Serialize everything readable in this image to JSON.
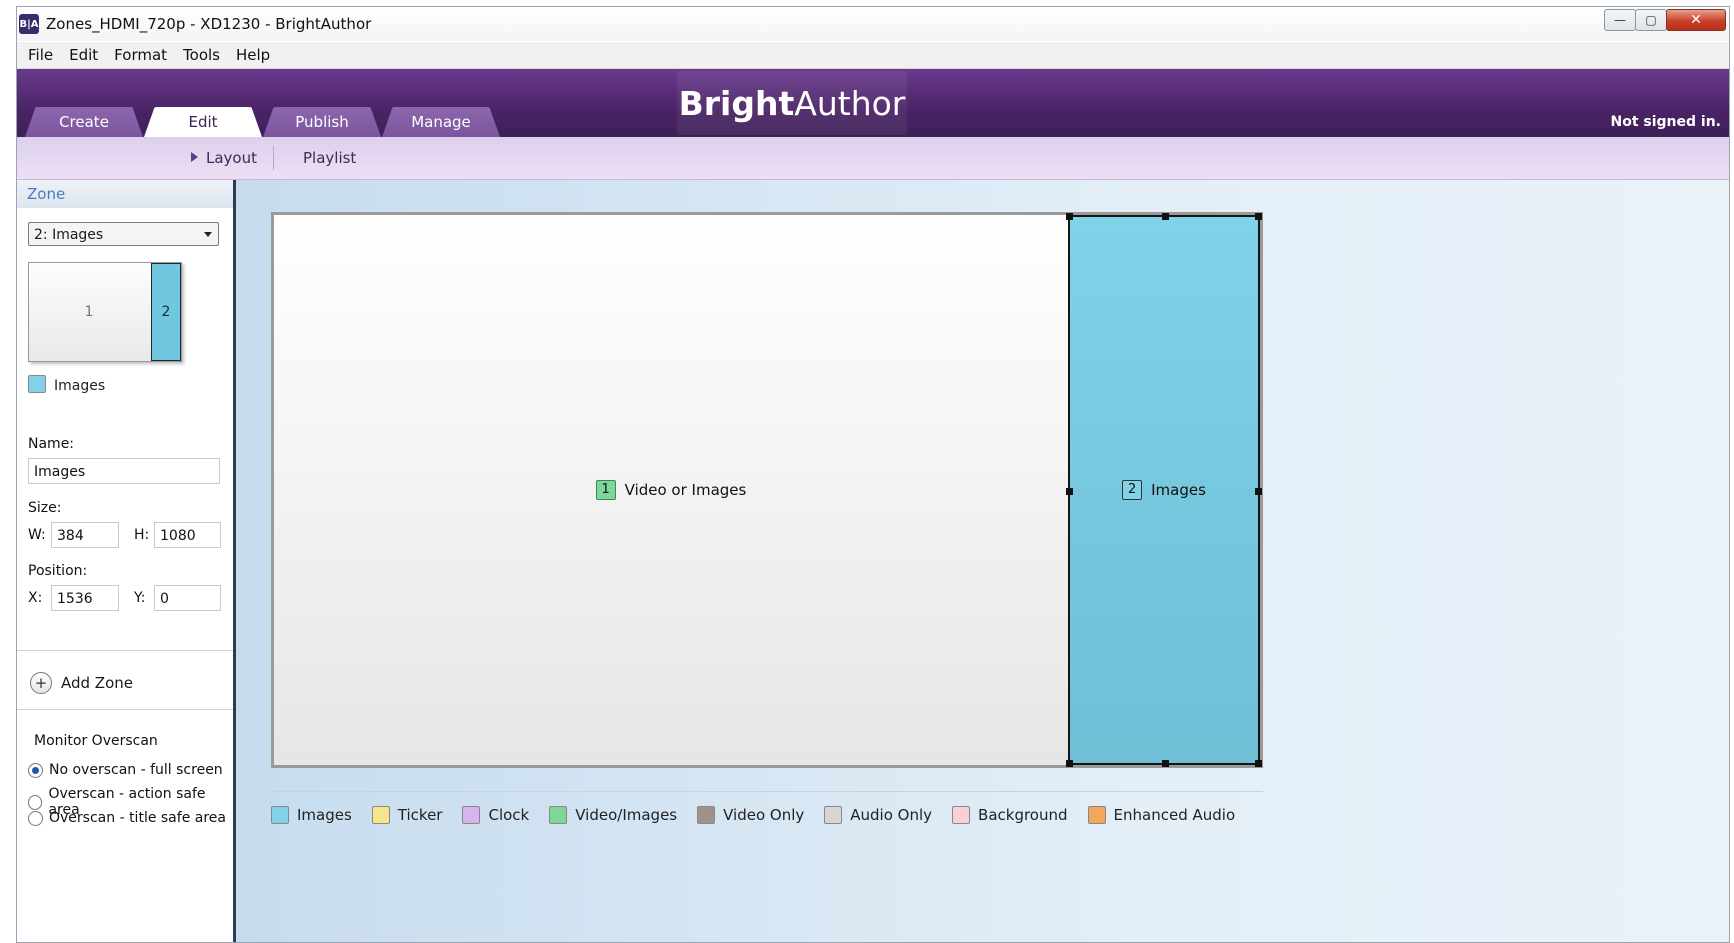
{
  "window": {
    "app_icon": "B|A",
    "title": "Zones_HDMI_720p - XD1230 - BrightAuthor",
    "controls": {
      "minimize": "—",
      "maximize": "▢",
      "close": "✕"
    }
  },
  "menu": [
    "File",
    "Edit",
    "Format",
    "Tools",
    "Help"
  ],
  "header": {
    "tabs": [
      "Create",
      "Edit",
      "Publish",
      "Manage"
    ],
    "active_tab": "Edit",
    "brand_bold": "Bright",
    "brand_light": "Author",
    "signin_status": "Not signed in."
  },
  "subnav": {
    "layout": "Layout",
    "playlist": "Playlist",
    "active": "Layout"
  },
  "left_panel": {
    "section_title": "Zone",
    "zone_select": "2: Images",
    "thumbnail": {
      "zone1": "1",
      "zone2": "2"
    },
    "zone_type": "Images",
    "zone_type_color": "#7fd2e8",
    "name_label": "Name:",
    "name_value": "Images",
    "size_label": "Size:",
    "w_label": "W:",
    "w_value": "384",
    "h_label": "H:",
    "h_value": "1080",
    "position_label": "Position:",
    "x_label": "X:",
    "x_value": "1536",
    "y_label": "Y:",
    "y_value": "0",
    "add_zone": "Add Zone",
    "overscan_title": "Monitor Overscan",
    "overscan_options": [
      "No overscan - full screen",
      "Overscan - action safe area",
      "Overscan - title safe area"
    ],
    "overscan_selected": "No overscan - full screen"
  },
  "canvas": {
    "zone1": {
      "number": "1",
      "label": "Video or Images"
    },
    "zone2": {
      "number": "2",
      "label": "Images"
    }
  },
  "legend": [
    {
      "label": "Images",
      "color": "#7fd2e8"
    },
    {
      "label": "Ticker",
      "color": "#f7e58a"
    },
    {
      "label": "Clock",
      "color": "#d7b3ef"
    },
    {
      "label": "Video/Images",
      "color": "#7fd59a"
    },
    {
      "label": "Video Only",
      "color": "#a1918a"
    },
    {
      "label": "Audio Only",
      "color": "#d6d6d6"
    },
    {
      "label": "Background",
      "color": "#f7d2d4"
    },
    {
      "label": "Enhanced Audio",
      "color": "#f4a65a"
    }
  ]
}
